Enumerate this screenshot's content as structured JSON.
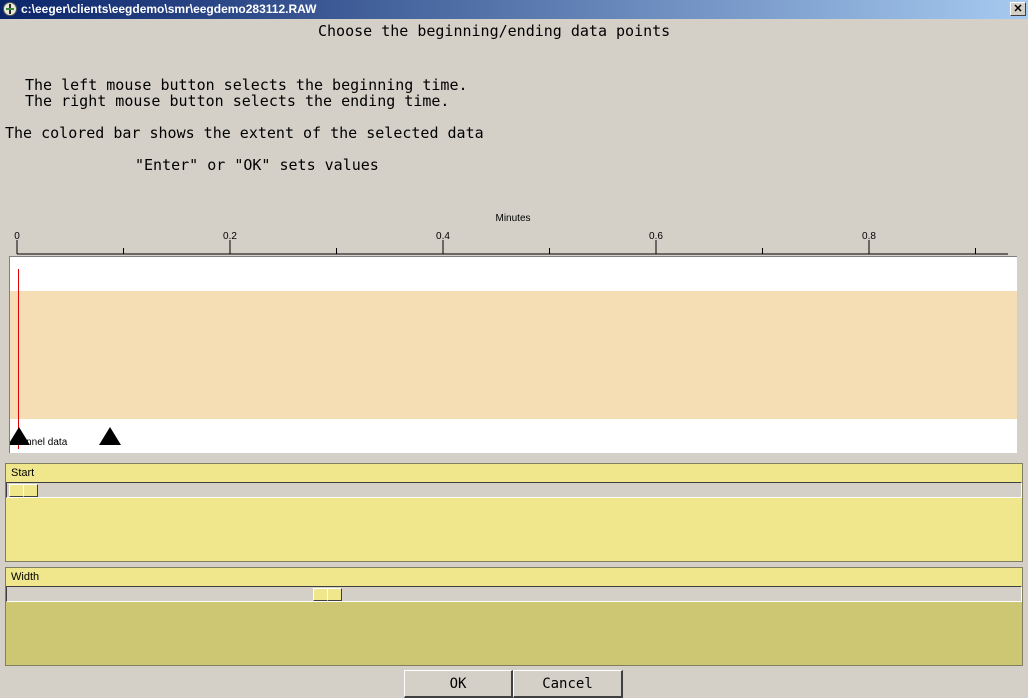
{
  "window": {
    "title": "c:\\eeger\\clients\\eegdemo\\smr\\eegdemo283112.RAW",
    "close_glyph": "✕"
  },
  "instructions": {
    "heading": "Choose the beginning/ending data points",
    "line1": "The left mouse button selects the beginning time.",
    "line2": "The right mouse button selects the ending time.",
    "line3": "The colored bar shows the extent of the selected data",
    "line4": "\"Enter\" or \"OK\" sets values"
  },
  "axis": {
    "label": "Minutes",
    "ticks": [
      "0",
      "0.2",
      "0.4",
      "0.6",
      "0.8"
    ]
  },
  "plot": {
    "channel_label": "channel data",
    "band_color": "#f5deb3",
    "cursor_color": "#e00000"
  },
  "start_panel": {
    "label": "Start",
    "value_fraction": 0.0
  },
  "width_panel": {
    "label": "Width",
    "value_fraction": 0.31
  },
  "buttons": {
    "ok": "OK",
    "cancel": "Cancel"
  },
  "colors": {
    "titlebar_start": "#0a246a",
    "titlebar_end": "#a6caf0",
    "panel_start": "#f0e68c",
    "panel_width": "#cdc673"
  }
}
